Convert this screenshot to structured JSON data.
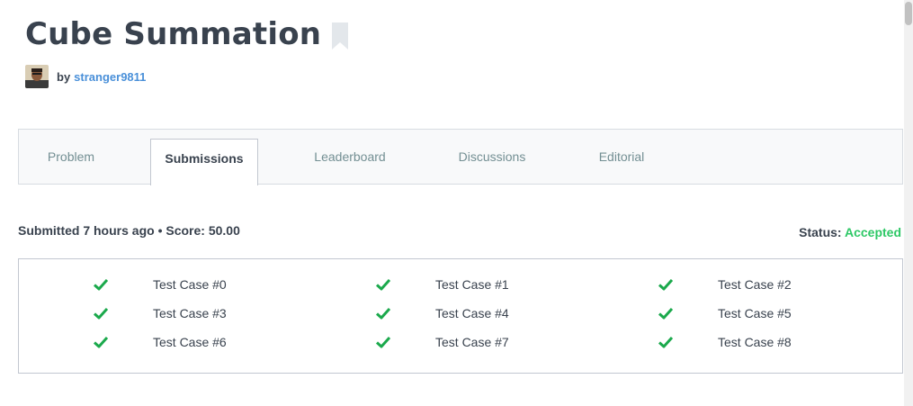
{
  "challenge": {
    "title": "Cube Summation",
    "by_label": "by",
    "author": "stranger9811"
  },
  "tabs": [
    {
      "label": "Problem",
      "active": false
    },
    {
      "label": "Submissions",
      "active": true
    },
    {
      "label": "Leaderboard",
      "active": false
    },
    {
      "label": "Discussions",
      "active": false
    },
    {
      "label": "Editorial",
      "active": false
    }
  ],
  "submission": {
    "submitted_text": "Submitted 7 hours ago • Score: 50.00",
    "status_label": "Status:",
    "status_value": "Accepted"
  },
  "test_cases": [
    {
      "label": "Test Case #0",
      "passed": true,
      "icon": "check-icon"
    },
    {
      "label": "Test Case #1",
      "passed": true,
      "icon": "check-icon"
    },
    {
      "label": "Test Case #2",
      "passed": true,
      "icon": "check-icon"
    },
    {
      "label": "Test Case #3",
      "passed": true,
      "icon": "check-icon"
    },
    {
      "label": "Test Case #4",
      "passed": true,
      "icon": "check-icon"
    },
    {
      "label": "Test Case #5",
      "passed": true,
      "icon": "check-icon"
    },
    {
      "label": "Test Case #6",
      "passed": true,
      "icon": "check-icon"
    },
    {
      "label": "Test Case #7",
      "passed": true,
      "icon": "check-icon"
    },
    {
      "label": "Test Case #8",
      "passed": true,
      "icon": "check-icon"
    }
  ],
  "colors": {
    "accepted": "#2ec866",
    "check": "#1ba94c",
    "author_link": "#4a90d9"
  }
}
